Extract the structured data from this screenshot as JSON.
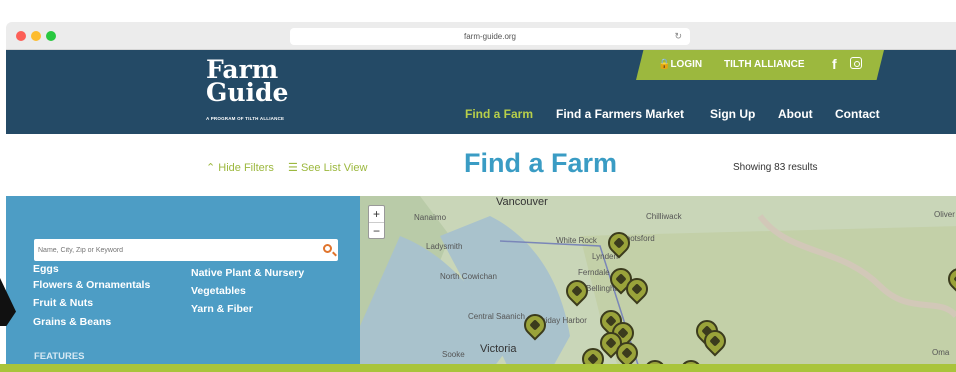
{
  "browser": {
    "url": "farm-guide.org"
  },
  "header": {
    "logo": {
      "line1": "Farm",
      "line2": "Guide",
      "tagline": "A PROGRAM OF TILTH ALLIANCE"
    },
    "top_bar": {
      "login": "LOGIN",
      "alliance": "TILTH ALLIANCE",
      "facebook": "f"
    },
    "nav": [
      {
        "label": "Find a Farm",
        "active": true
      },
      {
        "label": "Find a Farmers Market"
      },
      {
        "label": "Sign Up"
      },
      {
        "label": "About"
      },
      {
        "label": "Contact"
      }
    ]
  },
  "toolbar": {
    "hide_filters": "Hide Filters",
    "list_view": "See List View",
    "title": "Find a Farm",
    "results": "Showing 83 results"
  },
  "sidebar": {
    "search_placeholder": "Name, City, Zip or Keyword",
    "categories_left": [
      "Eggs",
      "Flowers & Ornamentals",
      "Fruit & Nuts",
      "Grains & Beans"
    ],
    "categories_right": [
      "Native Plant & Nursery",
      "Vegetables",
      "Yarn & Fiber"
    ],
    "features_heading": "FEATURES"
  },
  "map": {
    "zoom_in": "+",
    "zoom_out": "−",
    "labels": [
      "Vancouver",
      "Nanaimo",
      "Chilliwack",
      "Ladysmith",
      "North Cowichan",
      "Bellingham",
      "Ferndale",
      "Lynden",
      "Victoria",
      "Sooke",
      "Central Saanich",
      "Friday Harbor",
      "Oliver",
      "Oma",
      "White Rock",
      "Abbotsford"
    ]
  },
  "colors": {
    "header_bg": "#244a66",
    "accent_green": "#9cb83e",
    "title_blue": "#3a9cc4",
    "sidebar_blue": "#4d9dc5"
  }
}
